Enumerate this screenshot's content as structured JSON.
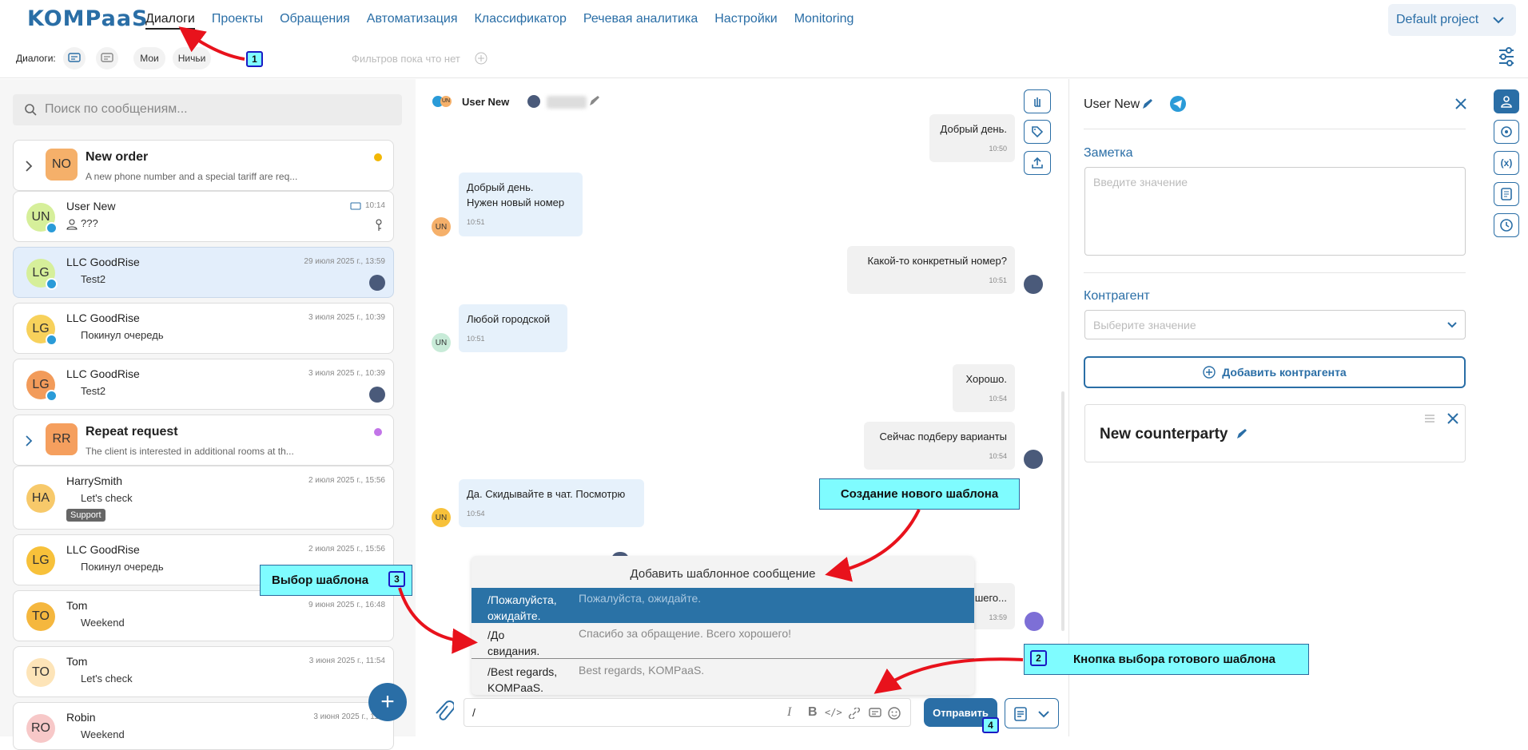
{
  "logo": "KOMPaaS",
  "nav": [
    "Диалоги",
    "Проекты",
    "Обращения",
    "Автоматизация",
    "Классификатор",
    "Речевая аналитика",
    "Настройки",
    "Monitoring"
  ],
  "project": "Default project",
  "filters": {
    "label": "Диалоги:",
    "mine": "Мои",
    "none": "Ничьи",
    "empty": "Фильтров пока что нет"
  },
  "search_placeholder": "Поиск по сообщениям...",
  "groups": [
    {
      "initials": "NO",
      "title": "New order",
      "desc": "A new phone number and a special tariff are req...",
      "dot": "#f2b705"
    },
    {
      "initials": "RR",
      "title": "Repeat request",
      "desc": "The client is interested in additional rooms at th...",
      "dot": "#c275e8"
    }
  ],
  "dialogs": [
    {
      "initials": "UN",
      "name": "User New",
      "msg": "???",
      "date": "10:14"
    },
    {
      "initials": "LG",
      "name": "LLC GoodRise",
      "msg": "Test2",
      "date": "29 июля 2025 г., 13:59"
    },
    {
      "initials": "LG",
      "name": "LLC GoodRise",
      "msg": "Покинул очередь",
      "date": "3 июля 2025 г., 10:39"
    },
    {
      "initials": "LG",
      "name": "LLC GoodRise",
      "msg": "Test2",
      "date": "3 июля 2025 г., 10:39"
    },
    {
      "initials": "HA",
      "name": "HarrySmith",
      "msg": "Let's check",
      "date": "2 июля 2025 г., 15:56",
      "badge": "Support"
    },
    {
      "initials": "LG",
      "name": "LLC GoodRise",
      "msg": "Покинул очередь",
      "date": "2 июля 2025 г., 15:56"
    },
    {
      "initials": "TO",
      "name": "Tom",
      "msg": "Weekend",
      "date": "9 июня 2025 г., 16:48"
    },
    {
      "initials": "TO",
      "name": "Tom",
      "msg": "Let's check",
      "date": "3 июня 2025 г., 11:54"
    },
    {
      "initials": "RO",
      "name": "Robin",
      "msg": "Weekend",
      "date": "3 июня 2025 г., 11:5"
    }
  ],
  "chat": {
    "title": "User New",
    "title_badge": "UN",
    "messages": [
      {
        "text": "Добрый день.",
        "time": "10:50"
      },
      {
        "text1": "Добрый день.",
        "text2": "Нужен новый номер",
        "time": "10:51",
        "av": "UN"
      },
      {
        "text": "Какой-то конкретный номер?",
        "time": "10:51"
      },
      {
        "text": "Любой городской",
        "time": "10:51",
        "av": "UN"
      },
      {
        "text": "Хорошо.",
        "time": "10:54"
      },
      {
        "text": "Сейчас подберу варианты",
        "time": "10:54"
      },
      {
        "text": "Да. Скидывайте в чат. Посмотрю",
        "time": "10:54",
        "av": "UN"
      },
      {
        "text": "шего...",
        "time": "13:59"
      }
    ],
    "input_value": "/",
    "send": "Отправить"
  },
  "templates": {
    "header": "Добавить шаблонное сообщение",
    "items": [
      {
        "key1": "/Пожалуйста,",
        "key2": "ожидайте.",
        "value": "Пожалуйста, ожидайте."
      },
      {
        "key1": "/До",
        "key2": "свидания.",
        "value": "Спасибо за обращение. Всего хорошего!"
      },
      {
        "key1": "/Best regards,",
        "key2": "KOMPaaS.",
        "value": "Best regards, KOMPaaS."
      }
    ]
  },
  "right": {
    "name": "User New",
    "note_label": "Заметка",
    "note_placeholder": "Введите значение",
    "contractor_label": "Контрагент",
    "contractor_placeholder": "Выберите значение",
    "add_contractor": "Добавить контрагента",
    "counterparty": "New counterparty"
  },
  "callouts": {
    "c1": "Создание нового шаблона",
    "c2": "Кнопка выбора готового шаблона",
    "c3": "Выбор шаблона",
    "n1": "1",
    "n2": "2",
    "n3": "3",
    "n4": "4"
  },
  "colors": {
    "accent": "#2a6ea6",
    "arrow": "#e8121c",
    "callout": "#7ffcff",
    "selected_row": "#2a72a6"
  }
}
